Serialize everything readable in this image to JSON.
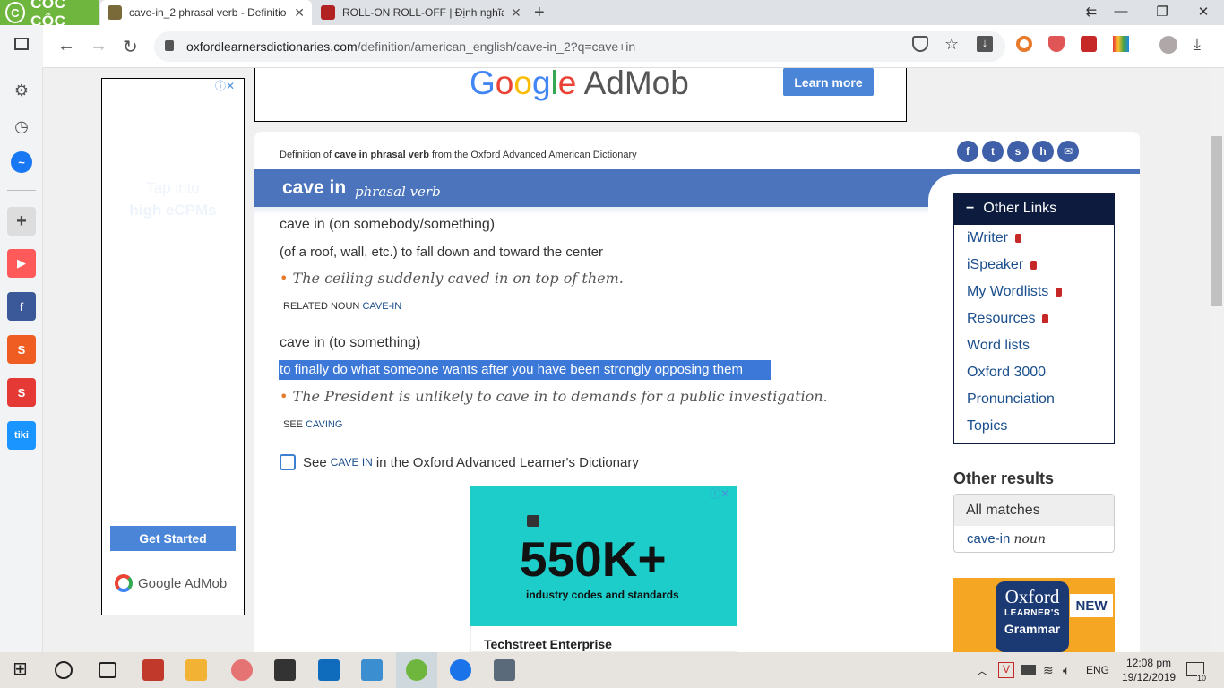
{
  "browser": {
    "brand": "CỐC CỐC",
    "tabs": [
      {
        "title": "cave-in_2 phrasal verb - Definition",
        "active": true
      },
      {
        "title": "ROLL-ON ROLL-OFF | Định nghĩa t",
        "active": false
      }
    ],
    "url_host": "oxfordlearnersdictionaries.com",
    "url_path": "/definition/american_english/cave-in_2?q=cave+in"
  },
  "ads": {
    "top_brand_parts": [
      "G",
      "o",
      "o",
      "g",
      "l",
      "e"
    ],
    "top_brand_suffix": " AdMob",
    "top_cta": "Learn more",
    "left_text1": "Tap into",
    "left_text2": "high eCPMs",
    "left_cta": "Get Started",
    "left_brand": "Google AdMob",
    "bottom_big": "550K+",
    "bottom_sub": "industry codes and standards",
    "bottom_name": "Techstreet Enterprise"
  },
  "entry": {
    "source_pre": "Definition of ",
    "source_word": "cave in phrasal verb",
    "source_post": " from the Oxford Advanced American Dictionary",
    "headword": "cave in",
    "pos": "phrasal verb",
    "senses": [
      {
        "phrase": "cave in (on somebody/something)",
        "definition": "(of a roof, wall, etc.) to fall down and toward the center",
        "example": "The ceiling suddenly caved in on top of them.",
        "xref_label": "RELATED NOUN",
        "xref_link": "CAVE-IN"
      },
      {
        "phrase": "cave in (to something)",
        "definition": "to finally do what someone wants after you have been strongly opposing them",
        "example": "The President is unlikely to cave in to demands for a public investigation.",
        "xref_label": "SEE",
        "xref_link": "CAVING"
      }
    ],
    "see_pre": "See",
    "see_link": "CAVE IN",
    "see_post": "in the Oxford Advanced Learner's Dictionary"
  },
  "sidebar": {
    "links_title": "Other Links",
    "links": [
      {
        "label": "iWriter",
        "locked": true
      },
      {
        "label": "iSpeaker",
        "locked": true
      },
      {
        "label": "My Wordlists",
        "locked": true
      },
      {
        "label": "Resources",
        "locked": true
      },
      {
        "label": "Word lists",
        "locked": false
      },
      {
        "label": "Oxford 3000",
        "locked": false
      },
      {
        "label": "Pronunciation",
        "locked": false
      },
      {
        "label": "Topics",
        "locked": false
      }
    ],
    "other_results": "Other results",
    "all_matches": "All matches",
    "match_word": "cave-in",
    "match_pos": "noun",
    "grammar_oxford": "Oxford",
    "grammar_learners": "LEARNER'S",
    "grammar_title": "Grammar",
    "grammar_new": "NEW"
  },
  "taskbar": {
    "lang": "ENG",
    "time": "12:08 pm",
    "date": "19/12/2019",
    "notif": "10"
  }
}
